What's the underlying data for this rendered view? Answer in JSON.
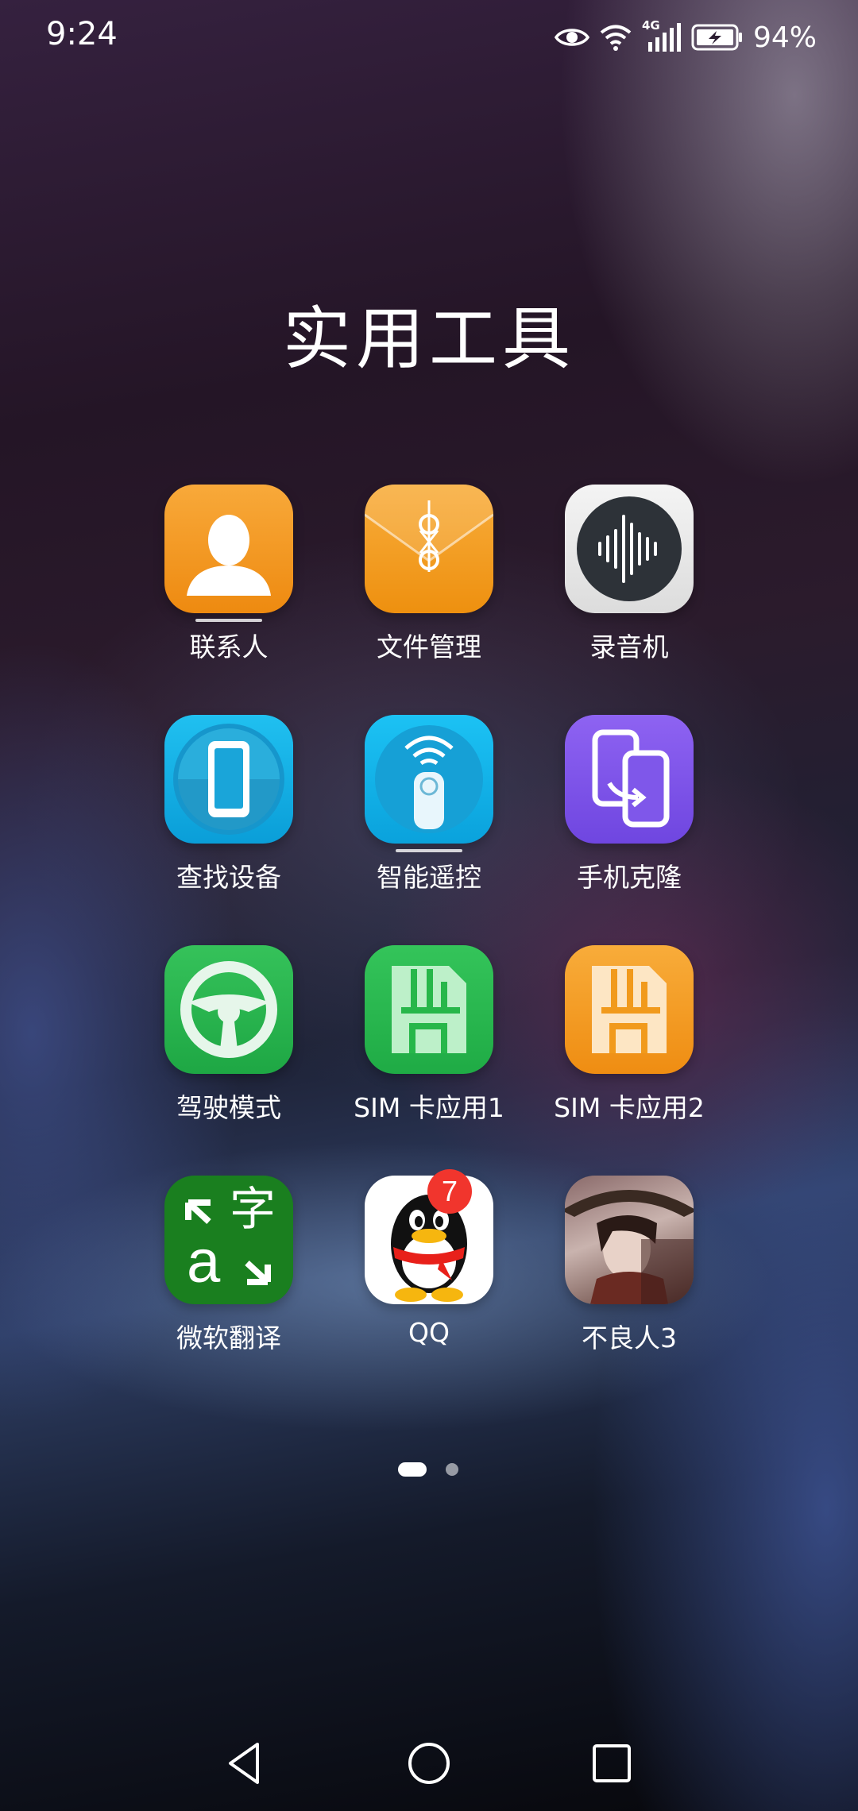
{
  "status_bar": {
    "time": "9:24",
    "network": "4G",
    "battery": "94%"
  },
  "folder": {
    "title": "实用工具"
  },
  "apps": [
    {
      "label": "联系人",
      "icon": "contacts-icon"
    },
    {
      "label": "文件管理",
      "icon": "file-manager-icon"
    },
    {
      "label": "录音机",
      "icon": "recorder-icon"
    },
    {
      "label": "查找设备",
      "icon": "find-device-icon"
    },
    {
      "label": "智能遥控",
      "icon": "smart-remote-icon"
    },
    {
      "label": "手机克隆",
      "icon": "phone-clone-icon"
    },
    {
      "label": "驾驶模式",
      "icon": "driving-mode-icon"
    },
    {
      "label": "SIM 卡应用1",
      "icon": "sim-card-icon"
    },
    {
      "label": "SIM 卡应用2",
      "icon": "sim-card-icon"
    },
    {
      "label": "微软翻译",
      "icon": "microsoft-translator-icon"
    },
    {
      "label": "QQ",
      "icon": "qq-penguin-icon",
      "badge": "7"
    },
    {
      "label": "不良人3",
      "icon": "game-character-icon"
    }
  ],
  "translator_glyph": "字",
  "translator_letter": "a",
  "page_indicator": {
    "current": 1,
    "total": 2
  },
  "navigation": {
    "back": "back-icon",
    "home": "home-icon",
    "recents": "recents-icon"
  },
  "colors": {
    "orange": "#f39a1c",
    "blue": "#12b0e8",
    "purple": "#7e55e8",
    "green": "#27b74a",
    "translator_green": "#1a7f1f",
    "badge_red": "#f1352d"
  }
}
